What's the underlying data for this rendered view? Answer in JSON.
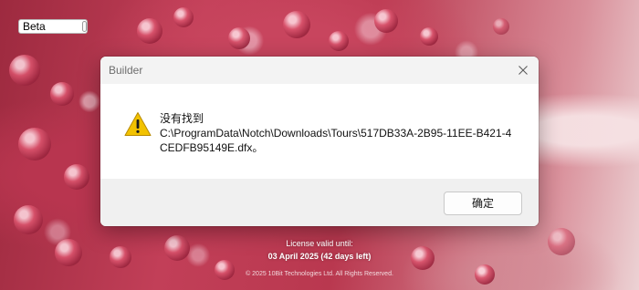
{
  "beta_tag": {
    "label": "Beta"
  },
  "dialog": {
    "title": "Builder",
    "message_lines": [
      "没有找到",
      "C:\\ProgramData\\Notch\\Downloads\\Tours\\517DB33A-2B95-11EE-B421-4",
      "CEDFB95149E.dfx。"
    ],
    "ok_label": "确定",
    "icon": "warning-icon",
    "close_icon": "close-icon"
  },
  "license": {
    "label": "License valid until:",
    "date": "03 April 2025 (42 days left)"
  },
  "copyright": "© 2025 10Bit Technologies Ltd. All Rights Reserved.",
  "colors": {
    "background_accent": "#b9384f",
    "warning_yellow": "#f2c200",
    "dialog_footer": "#f0f0f0"
  }
}
